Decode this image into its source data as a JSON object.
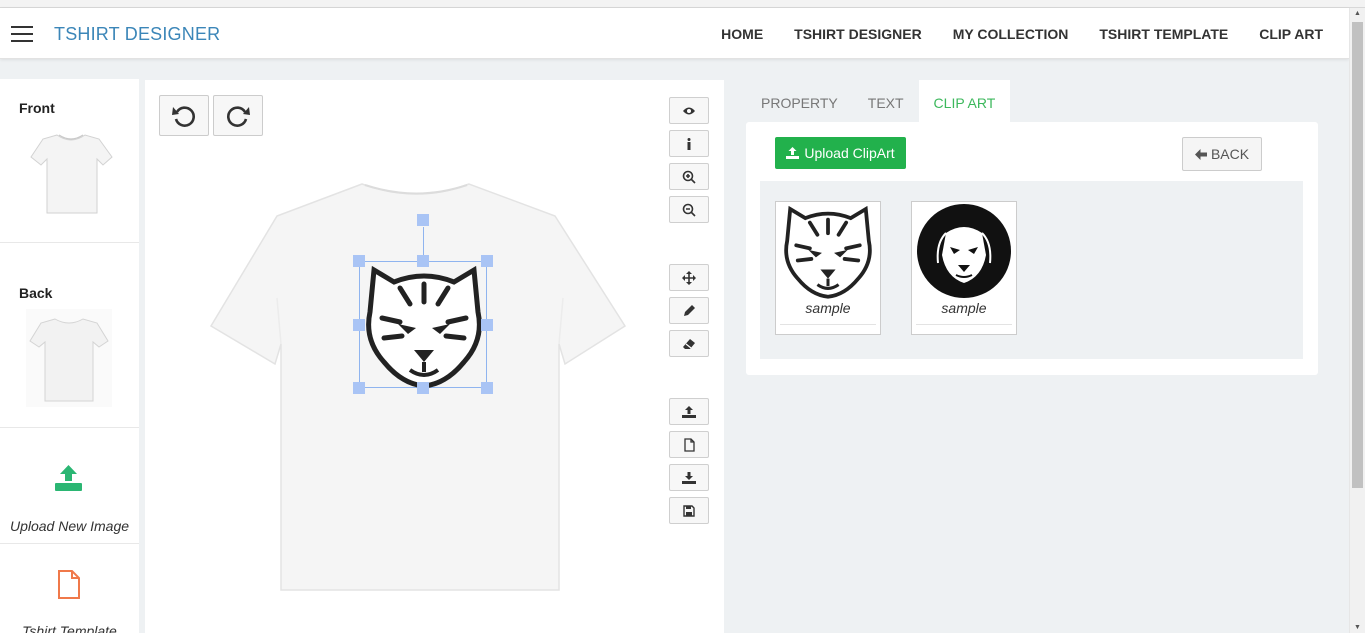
{
  "navbar": {
    "brand": "TSHIRT DESIGNER",
    "links": [
      "HOME",
      "TSHIRT DESIGNER",
      "MY COLLECTION",
      "TSHIRT TEMPLATE",
      "CLIP ART"
    ]
  },
  "sidebar": {
    "front_label": "Front",
    "back_label": "Back",
    "upload_label": "Upload New Image",
    "template_label": "Tshirt Template"
  },
  "tabs": [
    "PROPERTY",
    "TEXT",
    "CLIP ART"
  ],
  "active_tab": "CLIP ART",
  "clipart_panel": {
    "upload_button": "Upload ClipArt",
    "back_button": "BACK",
    "items": [
      {
        "caption": "sample",
        "icon": "tiger-head-icon"
      },
      {
        "caption": "sample",
        "icon": "lion-head-icon"
      }
    ]
  },
  "colors": {
    "brand": "#3b86b8",
    "accent_green": "#22b14c",
    "active_tab": "#3cb85c",
    "selection_handle": "#a9c4f5"
  }
}
